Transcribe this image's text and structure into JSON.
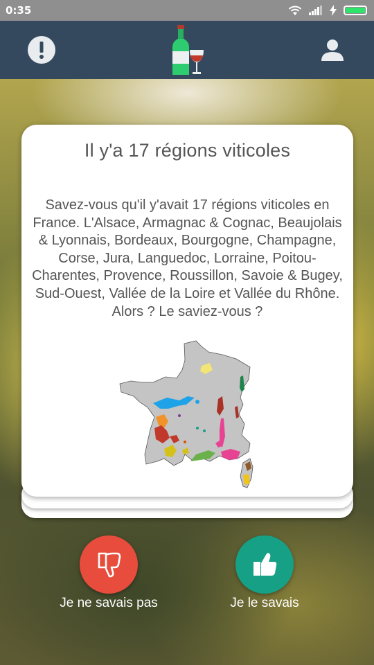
{
  "status_bar": {
    "time": "0:35",
    "icons": [
      "wifi-icon",
      "signal-icon",
      "charging-icon",
      "battery-icon"
    ],
    "battery_color": "#2ee46a"
  },
  "header": {
    "background": "#34495e",
    "left_icon": "alert-icon",
    "logo_icon": "wine-bottle-glass-icon",
    "right_icon": "user-icon"
  },
  "card": {
    "title": "Il y'a 17 régions viticoles",
    "body": "Savez-vous qu'il y'avait 17 régions viticoles en France. L'Alsace, Armagnac & Cognac, Beaujolais & Lyonnais, Bordeaux, Bourgogne, Champagne, Corse, Jura, Languedoc, Lorraine, Poitou-Charentes, Provence, Roussillon, Savoie & Bugey, Sud-Ouest, Vallée de la Loire et Vallée du Rhône. Alors ? Le saviez-vous ?",
    "image": "france-wine-regions-map"
  },
  "actions": {
    "dislike": {
      "label": "Je ne savais pas",
      "icon": "thumbs-down-icon",
      "color": "#e74c3c"
    },
    "like": {
      "label": "Je le savais",
      "icon": "thumbs-up-icon",
      "color": "#16a085"
    }
  }
}
